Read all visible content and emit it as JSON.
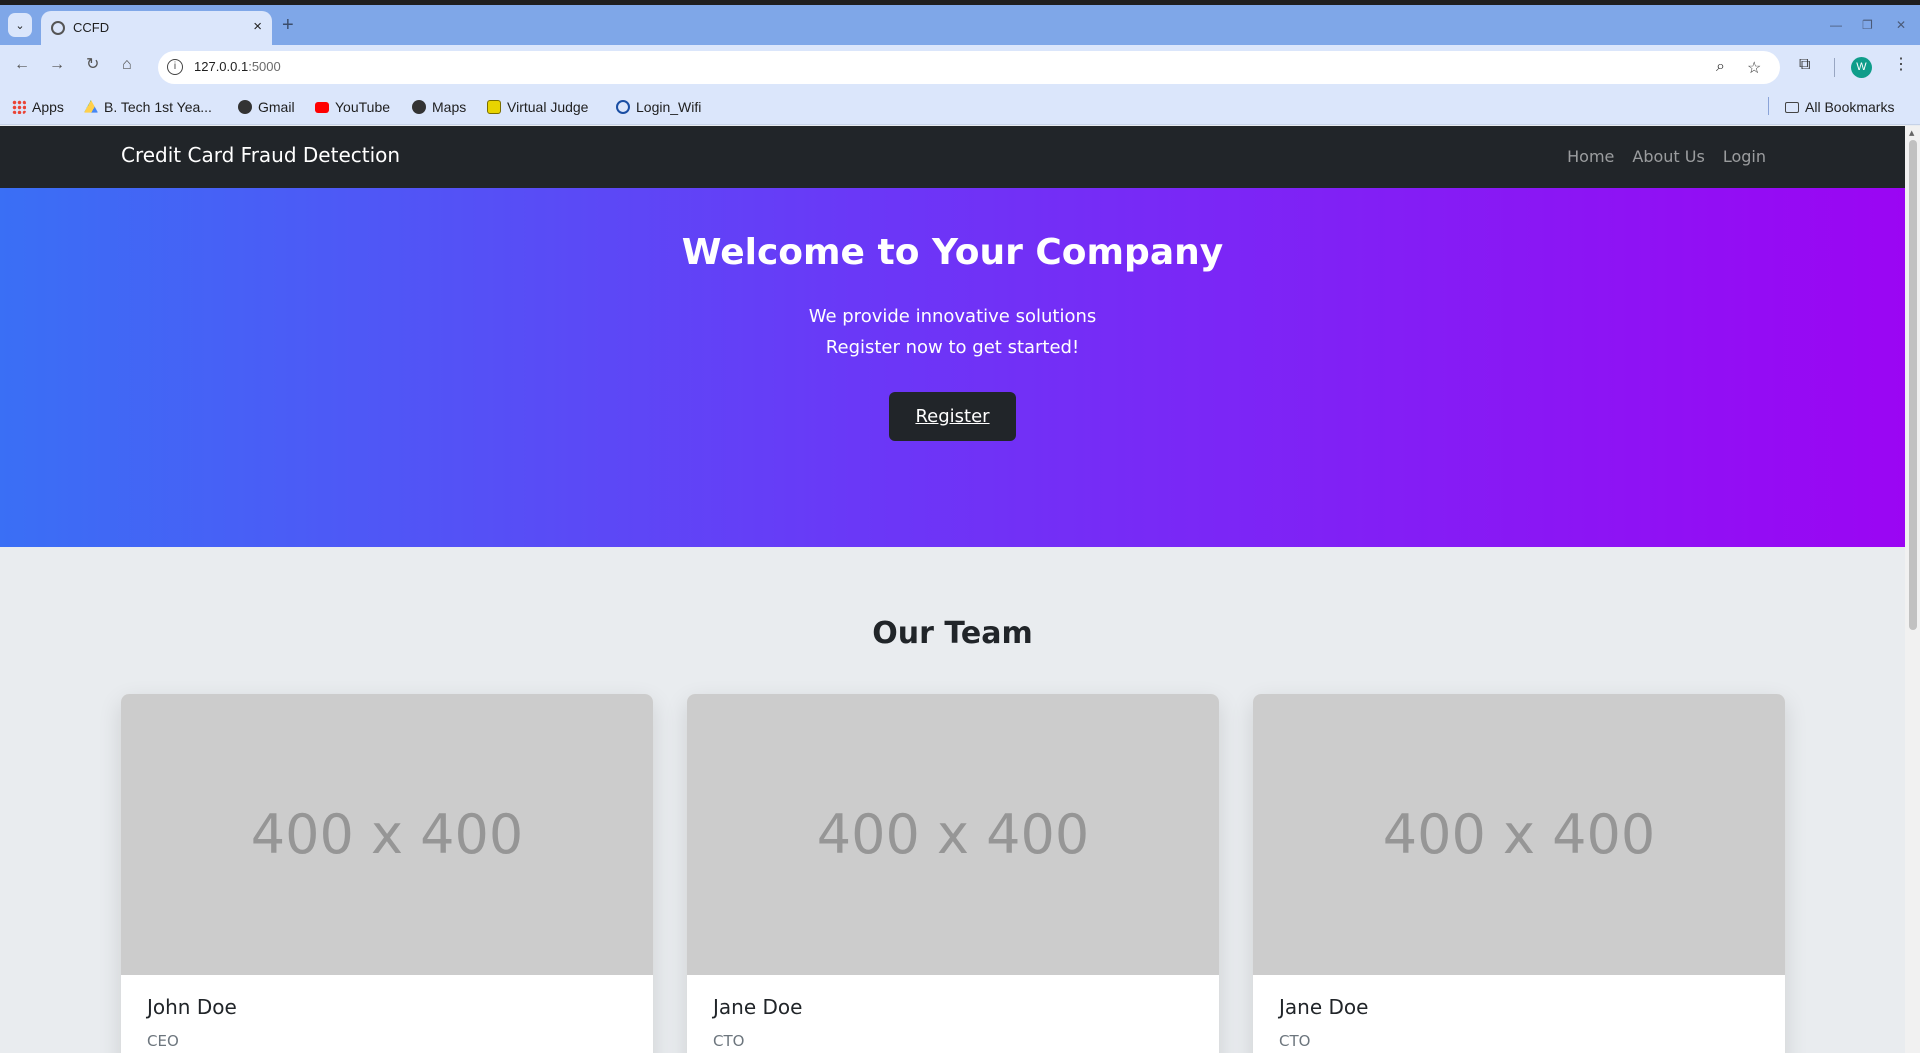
{
  "browser": {
    "tab_title": "CCFD",
    "tab_close": "×",
    "new_tab": "+",
    "url_host": "127.0.0.1",
    "url_port": ":5000",
    "profile_initial": "W",
    "bookmarks": [
      {
        "label": "Apps",
        "icon": "apps-grid-icon",
        "color": "#ea4335"
      },
      {
        "label": "B. Tech 1st Yea...",
        "icon": "google-drive-icon",
        "color": "#1fa463"
      },
      {
        "label": "Gmail",
        "icon": "globe-icon",
        "color": "#333333"
      },
      {
        "label": "YouTube",
        "icon": "youtube-icon",
        "color": "#ff0000"
      },
      {
        "label": "Maps",
        "icon": "globe-icon",
        "color": "#333333"
      },
      {
        "label": "Virtual Judge",
        "icon": "virtual-judge-icon",
        "color": "#c9b800"
      },
      {
        "label": "Login_Wifi",
        "icon": "login-wifi-icon",
        "color": "#1a4ea3"
      }
    ],
    "all_bookmarks": "All Bookmarks"
  },
  "site": {
    "brand": "Credit Card Fraud Detection",
    "nav": [
      "Home",
      "About Us",
      "Login"
    ]
  },
  "hero": {
    "title": "Welcome to Your Company",
    "line1": "We provide innovative solutions",
    "line2": "Register now to get started!",
    "cta": "Register"
  },
  "team": {
    "title": "Our Team",
    "members": [
      {
        "placeholder": "400 x 400",
        "name": "John Doe",
        "role": "CEO"
      },
      {
        "placeholder": "400 x 400",
        "name": "Jane Doe",
        "role": "CTO"
      },
      {
        "placeholder": "400 x 400",
        "name": "Jane Doe",
        "role": "CTO"
      }
    ]
  },
  "colors": {
    "navbar": "#212529",
    "hero_gradient_start": "#3a6ff5",
    "hero_gradient_end": "#9b05f3",
    "page_bg": "#e9ecef"
  }
}
